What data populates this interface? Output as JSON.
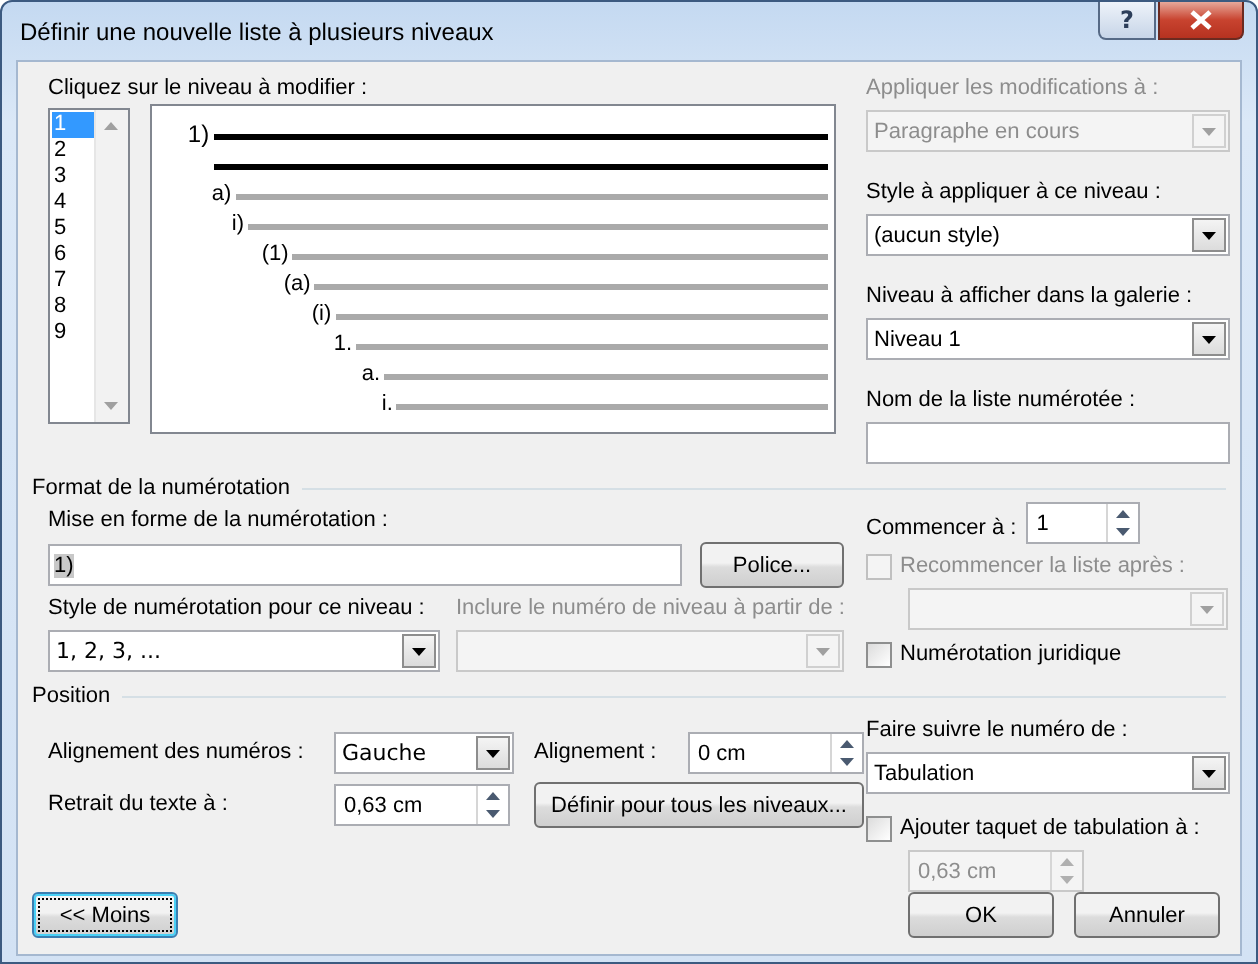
{
  "window": {
    "title": "Définir une nouvelle liste à plusieurs niveaux",
    "help_button": "?"
  },
  "level_picker": {
    "label": "Cliquez sur le niveau à modifier :",
    "levels": [
      {
        "label": "1",
        "selected": true
      },
      {
        "label": "2",
        "selected": false
      },
      {
        "label": "3",
        "selected": false
      },
      {
        "label": "4",
        "selected": false
      },
      {
        "label": "5",
        "selected": false
      },
      {
        "label": "6",
        "selected": false
      },
      {
        "label": "7",
        "selected": false
      },
      {
        "label": "8",
        "selected": false
      },
      {
        "label": "9",
        "selected": false
      }
    ]
  },
  "preview": {
    "numbers": [
      "1)",
      "a)",
      "i)",
      "(1)",
      "(a)",
      "(i)",
      "1.",
      "a.",
      "i."
    ]
  },
  "apply_to": {
    "label": "Appliquer les modifications à :",
    "value": "Paragraphe en cours",
    "disabled": true
  },
  "level_style": {
    "label": "Style à appliquer à ce niveau :",
    "value": "(aucun style)",
    "disabled": false
  },
  "gallery_level": {
    "label": "Niveau à afficher dans la galerie :",
    "value": "Niveau 1",
    "disabled": false
  },
  "list_name": {
    "label": "Nom de la liste numérotée :"
  },
  "number_format": {
    "title": "Format de la numérotation",
    "format_label": "Mise en forme de la numérotation :",
    "format_value": "1)",
    "font_button": "Police...",
    "style_label": "Style de numérotation pour ce niveau :",
    "style_value": "1, 2, 3, ...",
    "include_label": "Inclure le numéro de niveau à partir de :",
    "include_disabled": true,
    "start_label": "Commencer à :",
    "start_value": "1",
    "restart": {
      "label": "Recommencer la liste après :",
      "checked": false,
      "disabled": true
    },
    "restart_after_disabled": true,
    "legal": {
      "label": "Numérotation juridique",
      "checked": false,
      "disabled": false
    }
  },
  "position": {
    "title": "Position",
    "number_alignment": {
      "label": "Alignement des numéros :",
      "value": "Gauche"
    },
    "aligned_at": {
      "label": "Alignement :",
      "value": "0 cm"
    },
    "text_indent": {
      "label": "Retrait du texte à :",
      "value": "0,63 cm"
    },
    "set_all_button": "Définir pour tous les niveaux...",
    "follow_with": {
      "label": "Faire suivre le numéro de :",
      "value": "Tabulation"
    },
    "tab_stop": {
      "label": "Ajouter taquet de tabulation à :",
      "checked": false,
      "disabled": false
    },
    "tab_stop_value": {
      "value": "0,63 cm",
      "disabled": true
    }
  },
  "buttons": [
    {
      "label": "<< Moins",
      "focused": true
    },
    {
      "label": "OK",
      "focused": false
    },
    {
      "label": "Annuler",
      "focused": false
    }
  ]
}
